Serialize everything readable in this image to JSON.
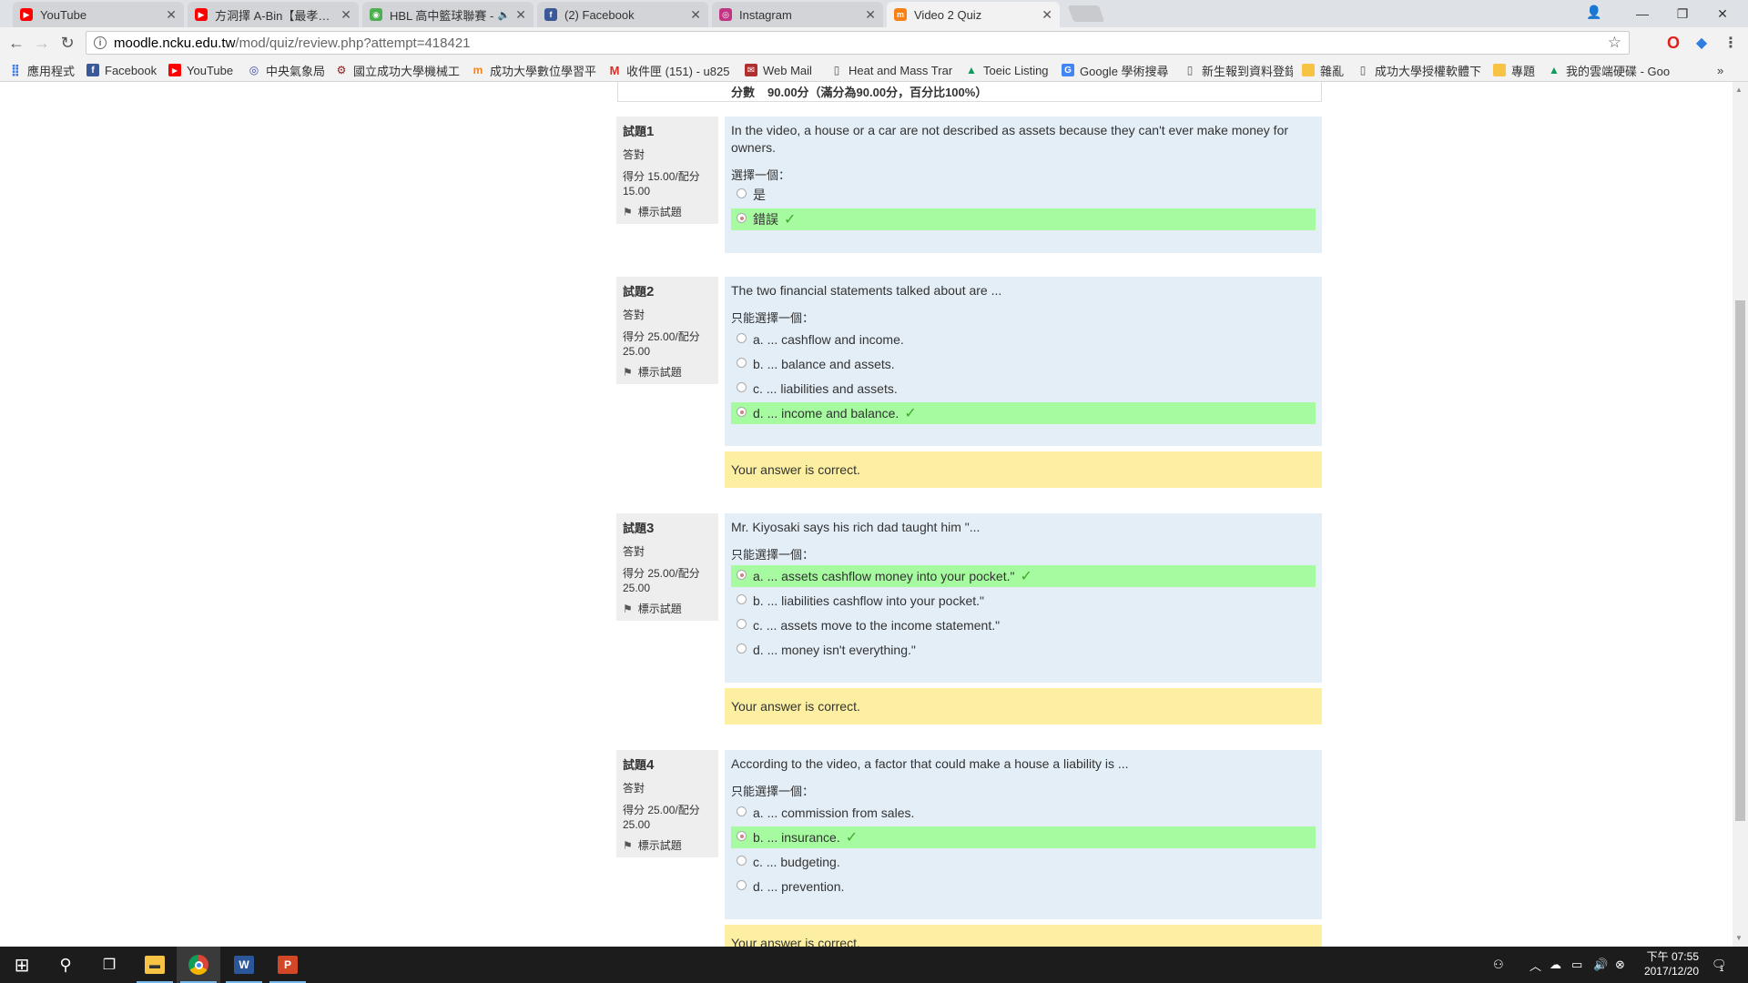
{
  "browser": {
    "tabs": [
      {
        "title": "YouTube",
        "favicon": "youtube-icon",
        "color": "#ff0000"
      },
      {
        "title": "方洞擇 A-Bin【最孝的人",
        "favicon": "youtube-icon",
        "color": "#ff0000"
      },
      {
        "title": "HBL 高中籃球聯賽 - ",
        "favicon": "globe-icon",
        "color": "#4caf50"
      },
      {
        "title": "(2) Facebook",
        "favicon": "facebook-icon",
        "color": "#3b5998"
      },
      {
        "title": "Instagram",
        "favicon": "instagram-icon",
        "color": "#c13584"
      },
      {
        "title": "Video 2 Quiz",
        "favicon": "moodle-icon",
        "color": "#f98012"
      }
    ],
    "active_tab_index": 5,
    "url_host": "moodle.ncku.edu.tw",
    "url_path": "/mod/quiz/review.php?attempt=418421",
    "bookmarks": [
      {
        "label": "應用程式",
        "icon": "apps-grid-icon"
      },
      {
        "label": "Facebook",
        "icon": "facebook-icon"
      },
      {
        "label": "YouTube",
        "icon": "youtube-icon"
      },
      {
        "label": "中央氣象局",
        "icon": "weather-icon"
      },
      {
        "label": "國立成功大學機械工",
        "icon": "ncku-icon"
      },
      {
        "label": "成功大學數位學習平",
        "icon": "moodle-icon"
      },
      {
        "label": "收件匣 (151) - u825",
        "icon": "gmail-icon"
      },
      {
        "label": "Web Mail",
        "icon": "webmail-icon"
      },
      {
        "label": "Heat and Mass Tran",
        "icon": "document-icon"
      },
      {
        "label": "Toeic Listing",
        "icon": "drive-icon"
      },
      {
        "label": "Google 學術搜尋",
        "icon": "scholar-icon"
      },
      {
        "label": "新生報到資料登錄",
        "icon": "document-icon"
      },
      {
        "label": "雜亂",
        "icon": "folder-icon"
      },
      {
        "label": "成功大學授權軟體下",
        "icon": "document-icon"
      },
      {
        "label": "專題",
        "icon": "folder-icon"
      },
      {
        "label": "我的雲端硬碟 - Goo",
        "icon": "drive-icon"
      }
    ],
    "bookmarks_overflow": "»"
  },
  "summary": {
    "label": "分數",
    "value": "90.00分（滿分為90.00分，百分比100%）"
  },
  "questions": [
    {
      "number_label": "試題",
      "number": "1",
      "state": "答對",
      "grade": "得分 15.00/配分 15.00",
      "flag_label": "標示試題",
      "text": "In the video, a house or a car are not described as assets because they can't ever make money for owners.",
      "prompt": "選擇一個：",
      "answers": [
        {
          "label": "是",
          "selected": false,
          "correct": false
        },
        {
          "label": "錯誤",
          "selected": true,
          "correct": true
        }
      ],
      "feedback": ""
    },
    {
      "number_label": "試題",
      "number": "2",
      "state": "答對",
      "grade": "得分 25.00/配分 25.00",
      "flag_label": "標示試題",
      "text": "The two financial statements talked about are ...",
      "prompt": "只能選擇一個：",
      "answers": [
        {
          "label": "a. ... cashflow and income.",
          "selected": false,
          "correct": false
        },
        {
          "label": "b. ... balance and assets.",
          "selected": false,
          "correct": false
        },
        {
          "label": "c. ... liabilities and assets.",
          "selected": false,
          "correct": false
        },
        {
          "label": "d. ... income and balance.",
          "selected": true,
          "correct": true
        }
      ],
      "feedback": "Your answer is correct."
    },
    {
      "number_label": "試題",
      "number": "3",
      "state": "答對",
      "grade": "得分 25.00/配分 25.00",
      "flag_label": "標示試題",
      "text": "Mr. Kiyosaki says his rich dad taught him \"...",
      "prompt": "只能選擇一個：",
      "answers": [
        {
          "label": "a. ... assets cashflow money into your pocket.\"",
          "selected": true,
          "correct": true
        },
        {
          "label": "b. ... liabilities cashflow into your pocket.\"",
          "selected": false,
          "correct": false
        },
        {
          "label": "c. ... assets move to the income statement.\"",
          "selected": false,
          "correct": false
        },
        {
          "label": "d. ... money isn't everything.\"",
          "selected": false,
          "correct": false
        }
      ],
      "feedback": "Your answer is correct."
    },
    {
      "number_label": "試題",
      "number": "4",
      "state": "答對",
      "grade": "得分 25.00/配分 25.00",
      "flag_label": "標示試題",
      "text": "According to the video, a factor that could make a house a liability is ...",
      "prompt": "只能選擇一個：",
      "answers": [
        {
          "label": "a. ... commission from sales.",
          "selected": false,
          "correct": false
        },
        {
          "label": "b. ... insurance.",
          "selected": true,
          "correct": true
        },
        {
          "label": "c. ... budgeting.",
          "selected": false,
          "correct": false
        },
        {
          "label": "d. ... prevention.",
          "selected": false,
          "correct": false
        }
      ],
      "feedback": "Your answer is correct."
    }
  ],
  "taskbar": {
    "apps": [
      "start-icon",
      "search-icon",
      "task-view-icon",
      "file-explorer-icon",
      "chrome-icon",
      "word-icon",
      "powerpoint-icon"
    ],
    "clock_time": "下午 07:55",
    "clock_date": "2017/12/20",
    "notification_count": "1"
  },
  "colors": {
    "question_bg": "#e3eef7",
    "correct_answer_bg": "#a6fa9f",
    "feedback_bg": "#fcefa1",
    "info_bg": "#eeeeee"
  }
}
